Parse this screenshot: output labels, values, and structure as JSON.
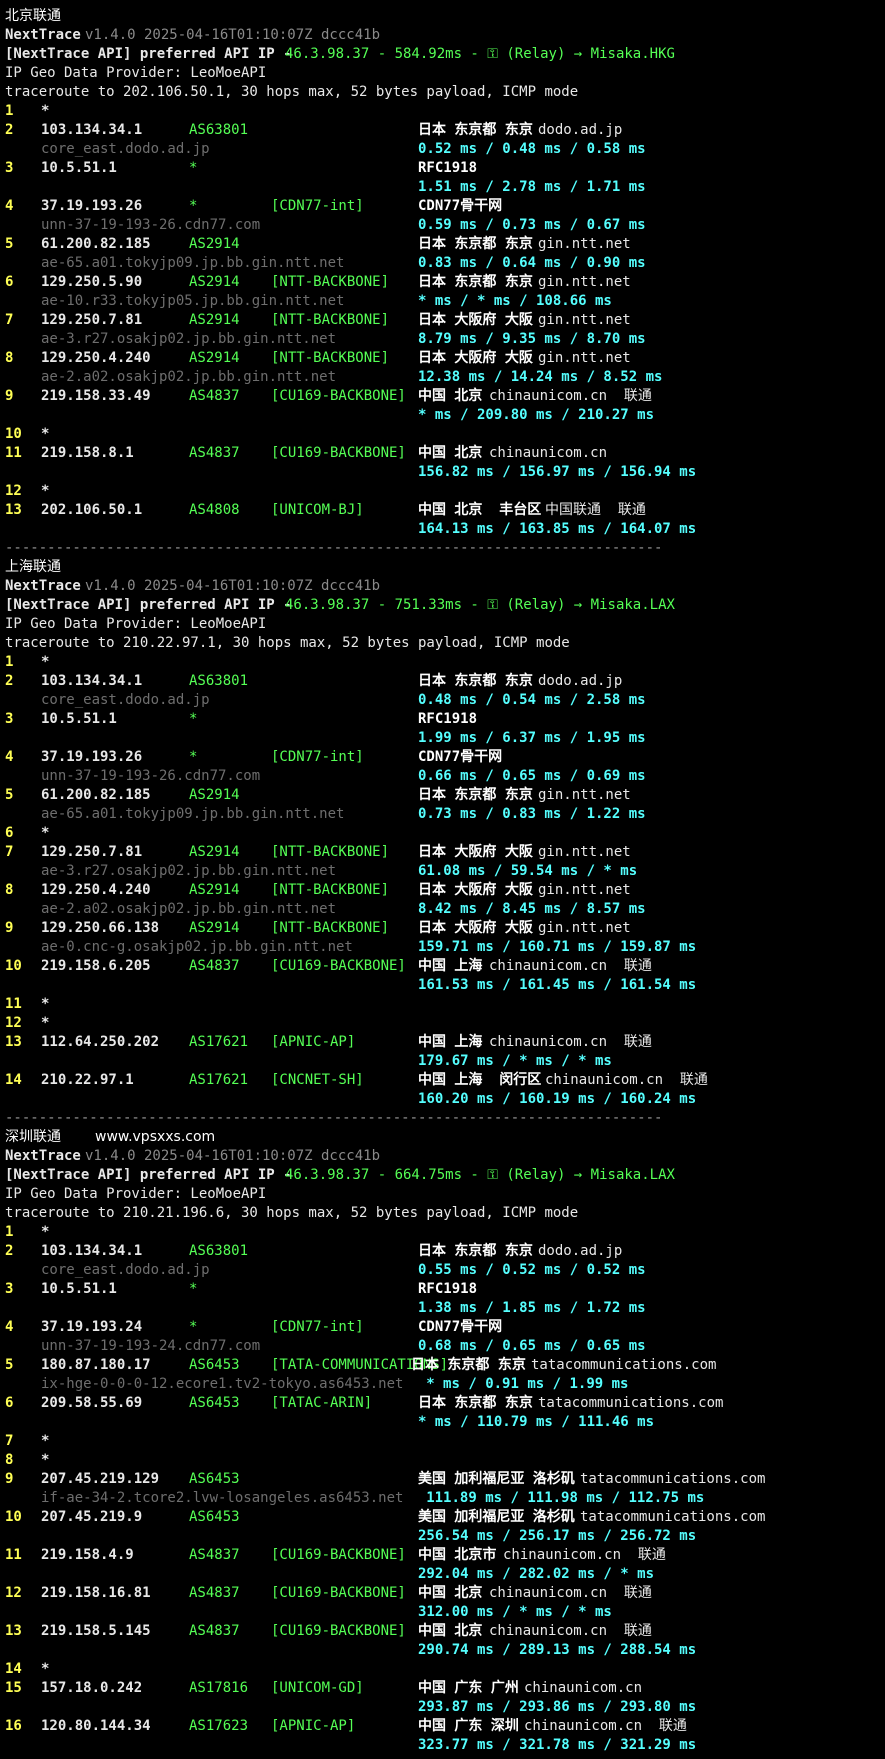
{
  "colors": {
    "background": "#000000",
    "hop": "#ffff55",
    "asn": "#55ff55",
    "rtt": "#55ffff",
    "rdns": "#6e6e6e"
  },
  "watermark": "www.vpsxxs.com",
  "separator": "------------------------------------------------------------------------------",
  "sections": [
    {
      "title": "北京联通",
      "header": {
        "name": "NextTrace",
        "version": "v1.4.0 2025-04-16T01:10:07Z dccc41b",
        "api_prefix": "[NextTrace API] preferred API IP - ",
        "api_ip": "46.3.98.37 - 584.92ms - ⚿ (Relay) → Misaka.HKG",
        "geo_provider": "IP Geo Data Provider: LeoMoeAPI",
        "traceroute": "traceroute to 202.106.50.1, 30 hops max, 52 bytes payload, ICMP mode"
      },
      "hops": [
        {
          "n": "1",
          "ip": "*"
        },
        {
          "n": "2",
          "ip": "103.134.34.1",
          "asn": "AS63801",
          "tag": "",
          "geo": "日本 东京都 东京",
          "dom": "dodo.ad.jp",
          "rdns": "core_east.dodo.ad.jp",
          "rtt": "0.52 ms / 0.48 ms / 0.58 ms"
        },
        {
          "n": "3",
          "ip": "10.5.51.1",
          "asn": "*",
          "tag": "",
          "geo": "RFC1918",
          "dom": "",
          "rdns": "",
          "rtt": "1.51 ms / 2.78 ms / 1.71 ms"
        },
        {
          "n": "4",
          "ip": "37.19.193.26",
          "asn": "*",
          "tag": "[CDN77-int]",
          "geo": "CDN77骨干网",
          "dom": "",
          "rdns": "unn-37-19-193-26.cdn77.com",
          "rtt": "0.59 ms / 0.73 ms / 0.67 ms"
        },
        {
          "n": "5",
          "ip": "61.200.82.185",
          "asn": "AS2914",
          "tag": "",
          "geo": "日本 东京都 东京",
          "dom": "gin.ntt.net",
          "rdns": "ae-65.a01.tokyjp09.jp.bb.gin.ntt.net",
          "rtt": "0.83 ms / 0.64 ms / 0.90 ms"
        },
        {
          "n": "6",
          "ip": "129.250.5.90",
          "asn": "AS2914",
          "tag": "[NTT-BACKBONE]",
          "geo": "日本 东京都 东京",
          "dom": "gin.ntt.net",
          "rdns": "ae-10.r33.tokyjp05.jp.bb.gin.ntt.net",
          "rtt": "* ms / * ms / 108.66 ms"
        },
        {
          "n": "7",
          "ip": "129.250.7.81",
          "asn": "AS2914",
          "tag": "[NTT-BACKBONE]",
          "geo": "日本 大阪府 大阪",
          "dom": "gin.ntt.net",
          "rdns": "ae-3.r27.osakjp02.jp.bb.gin.ntt.net",
          "rtt": "8.79 ms / 9.35 ms / 8.70 ms"
        },
        {
          "n": "8",
          "ip": "129.250.4.240",
          "asn": "AS2914",
          "tag": "[NTT-BACKBONE]",
          "geo": "日本 大阪府 大阪",
          "dom": "gin.ntt.net",
          "rdns": "ae-2.a02.osakjp02.jp.bb.gin.ntt.net",
          "rtt": "12.38 ms / 14.24 ms / 8.52 ms"
        },
        {
          "n": "9",
          "ip": "219.158.33.49",
          "asn": "AS4837",
          "tag": "[CU169-BACKBONE]",
          "geo": "中国 北京",
          "dom": "chinaunicom.cn  联通",
          "rdns": "",
          "rtt": "* ms / 209.80 ms / 210.27 ms"
        },
        {
          "n": "10",
          "ip": "*"
        },
        {
          "n": "11",
          "ip": "219.158.8.1",
          "asn": "AS4837",
          "tag": "[CU169-BACKBONE]",
          "geo": "中国 北京",
          "dom": "chinaunicom.cn",
          "rdns": "",
          "rtt": "156.82 ms / 156.97 ms / 156.94 ms"
        },
        {
          "n": "12",
          "ip": "*"
        },
        {
          "n": "13",
          "ip": "202.106.50.1",
          "asn": "AS4808",
          "tag": "[UNICOM-BJ]",
          "geo": "中国 北京  丰台区",
          "dom": "中国联通  联通",
          "rdns": "",
          "rtt": "164.13 ms / 163.85 ms / 164.07 ms"
        }
      ]
    },
    {
      "title": "上海联通",
      "header": {
        "name": "NextTrace",
        "version": "v1.4.0 2025-04-16T01:10:07Z dccc41b",
        "api_prefix": "[NextTrace API] preferred API IP - ",
        "api_ip": "46.3.98.37 - 751.33ms - ⚿ (Relay) → Misaka.LAX",
        "geo_provider": "IP Geo Data Provider: LeoMoeAPI",
        "traceroute": "traceroute to 210.22.97.1, 30 hops max, 52 bytes payload, ICMP mode"
      },
      "hops": [
        {
          "n": "1",
          "ip": "*"
        },
        {
          "n": "2",
          "ip": "103.134.34.1",
          "asn": "AS63801",
          "tag": "",
          "geo": "日本 东京都 东京",
          "dom": "dodo.ad.jp",
          "rdns": "core_east.dodo.ad.jp",
          "rtt": "0.48 ms / 0.54 ms / 2.58 ms"
        },
        {
          "n": "3",
          "ip": "10.5.51.1",
          "asn": "*",
          "tag": "",
          "geo": "RFC1918",
          "dom": "",
          "rdns": "",
          "rtt": "1.99 ms / 6.37 ms / 1.95 ms"
        },
        {
          "n": "4",
          "ip": "37.19.193.26",
          "asn": "*",
          "tag": "[CDN77-int]",
          "geo": "CDN77骨干网",
          "dom": "",
          "rdns": "unn-37-19-193-26.cdn77.com",
          "rtt": "0.66 ms / 0.65 ms / 0.69 ms"
        },
        {
          "n": "5",
          "ip": "61.200.82.185",
          "asn": "AS2914",
          "tag": "",
          "geo": "日本 东京都 东京",
          "dom": "gin.ntt.net",
          "rdns": "ae-65.a01.tokyjp09.jp.bb.gin.ntt.net",
          "rtt": "0.73 ms / 0.83 ms / 1.22 ms"
        },
        {
          "n": "6",
          "ip": "*"
        },
        {
          "n": "7",
          "ip": "129.250.7.81",
          "asn": "AS2914",
          "tag": "[NTT-BACKBONE]",
          "geo": "日本 大阪府 大阪",
          "dom": "gin.ntt.net",
          "rdns": "ae-3.r27.osakjp02.jp.bb.gin.ntt.net",
          "rtt": "61.08 ms / 59.54 ms / * ms"
        },
        {
          "n": "8",
          "ip": "129.250.4.240",
          "asn": "AS2914",
          "tag": "[NTT-BACKBONE]",
          "geo": "日本 大阪府 大阪",
          "dom": "gin.ntt.net",
          "rdns": "ae-2.a02.osakjp02.jp.bb.gin.ntt.net",
          "rtt": "8.42 ms / 8.45 ms / 8.57 ms"
        },
        {
          "n": "9",
          "ip": "129.250.66.138",
          "asn": "AS2914",
          "tag": "[NTT-BACKBONE]",
          "geo": "日本 大阪府 大阪",
          "dom": "gin.ntt.net",
          "rdns": "ae-0.cnc-g.osakjp02.jp.bb.gin.ntt.net",
          "rtt": "159.71 ms / 160.71 ms / 159.87 ms"
        },
        {
          "n": "10",
          "ip": "219.158.6.205",
          "asn": "AS4837",
          "tag": "[CU169-BACKBONE]",
          "geo": "中国 上海",
          "dom": "chinaunicom.cn  联通",
          "rdns": "",
          "rtt": "161.53 ms / 161.45 ms / 161.54 ms"
        },
        {
          "n": "11",
          "ip": "*"
        },
        {
          "n": "12",
          "ip": "*"
        },
        {
          "n": "13",
          "ip": "112.64.250.202",
          "asn": "AS17621",
          "tag": "[APNIC-AP]",
          "geo": "中国 上海",
          "dom": "chinaunicom.cn  联通",
          "rdns": "",
          "rtt": "179.67 ms / * ms / * ms"
        },
        {
          "n": "14",
          "ip": "210.22.97.1",
          "asn": "AS17621",
          "tag": "[CNCNET-SH]",
          "geo": "中国 上海  闵行区",
          "dom": "chinaunicom.cn  联通",
          "rdns": "",
          "rtt": "160.20 ms / 160.19 ms / 160.24 ms"
        }
      ]
    },
    {
      "title": "深圳联通",
      "header": {
        "name": "NextTrace",
        "version": "v1.4.0 2025-04-16T01:10:07Z dccc41b",
        "api_prefix": "[NextTrace API] preferred API IP - ",
        "api_ip": "46.3.98.37 - 664.75ms - ⚿ (Relay) → Misaka.LAX",
        "geo_provider": "IP Geo Data Provider: LeoMoeAPI",
        "traceroute": "traceroute to 210.21.196.6, 30 hops max, 52 bytes payload, ICMP mode"
      },
      "hops": [
        {
          "n": "1",
          "ip": "*"
        },
        {
          "n": "2",
          "ip": "103.134.34.1",
          "asn": "AS63801",
          "tag": "",
          "geo": "日本 东京都 东京",
          "dom": "dodo.ad.jp",
          "rdns": "core_east.dodo.ad.jp",
          "rtt": "0.55 ms / 0.52 ms / 0.52 ms"
        },
        {
          "n": "3",
          "ip": "10.5.51.1",
          "asn": "*",
          "tag": "",
          "geo": "RFC1918",
          "dom": "",
          "rdns": "",
          "rtt": "1.38 ms / 1.85 ms / 1.72 ms"
        },
        {
          "n": "4",
          "ip": "37.19.193.24",
          "asn": "*",
          "tag": "[CDN77-int]",
          "geo": "CDN77骨干网",
          "dom": "",
          "rdns": "unn-37-19-193-24.cdn77.com",
          "rtt": "0.68 ms / 0.65 ms / 0.65 ms"
        },
        {
          "n": "5",
          "ip": "180.87.180.17",
          "asn": "AS6453",
          "tag": "[TATA-COMMUNICATIONS]",
          "geo": "日本 东京都 东京",
          "dom": "tatacommunications.com",
          "rdns": "ix-hge-0-0-0-12.ecore1.tv2-tokyo.as6453.net",
          "rtt": "* ms / 0.91 ms / 1.99 ms",
          "shift": true
        },
        {
          "n": "6",
          "ip": "209.58.55.69",
          "asn": "AS6453",
          "tag": "[TATAC-ARIN]",
          "geo": "日本 东京都 东京",
          "dom": "tatacommunications.com",
          "rdns": "",
          "rtt": "* ms / 110.79 ms / 111.46 ms"
        },
        {
          "n": "7",
          "ip": "*"
        },
        {
          "n": "8",
          "ip": "*"
        },
        {
          "n": "9",
          "ip": "207.45.219.129",
          "asn": "AS6453",
          "tag": "",
          "geo": "美国 加利福尼亚 洛杉矶",
          "dom": "tatacommunications.com",
          "rdns": "if-ae-34-2.tcore2.lvw-losangeles.as6453.net",
          "rtt": "111.89 ms / 111.98 ms / 112.75 ms",
          "shift": true
        },
        {
          "n": "10",
          "ip": "207.45.219.9",
          "asn": "AS6453",
          "tag": "",
          "geo": "美国 加利福尼亚 洛杉矶",
          "dom": "tatacommunications.com",
          "rdns": "",
          "rtt": "256.54 ms / 256.17 ms / 256.72 ms"
        },
        {
          "n": "11",
          "ip": "219.158.4.9",
          "asn": "AS4837",
          "tag": "[CU169-BACKBONE]",
          "geo": "中国 北京市",
          "dom": "chinaunicom.cn  联通",
          "rdns": "",
          "rtt": "292.04 ms / 282.02 ms / * ms"
        },
        {
          "n": "12",
          "ip": "219.158.16.81",
          "asn": "AS4837",
          "tag": "[CU169-BACKBONE]",
          "geo": "中国 北京",
          "dom": "chinaunicom.cn  联通",
          "rdns": "",
          "rtt": "312.00 ms / * ms / * ms"
        },
        {
          "n": "13",
          "ip": "219.158.5.145",
          "asn": "AS4837",
          "tag": "[CU169-BACKBONE]",
          "geo": "中国 北京",
          "dom": "chinaunicom.cn  联通",
          "rdns": "",
          "rtt": "290.74 ms / 289.13 ms / 288.54 ms"
        },
        {
          "n": "14",
          "ip": "*"
        },
        {
          "n": "15",
          "ip": "157.18.0.242",
          "asn": "AS17816",
          "tag": "[UNICOM-GD]",
          "geo": "中国 广东 广州",
          "dom": "chinaunicom.cn",
          "rdns": "",
          "rtt": "293.87 ms / 293.86 ms / 293.80 ms"
        },
        {
          "n": "16",
          "ip": "120.80.144.34",
          "asn": "AS17623",
          "tag": "[APNIC-AP]",
          "geo": "中国 广东 深圳",
          "dom": "chinaunicom.cn  联通",
          "rdns": "",
          "rtt": "323.77 ms / 321.78 ms / 321.29 ms"
        }
      ]
    }
  ]
}
